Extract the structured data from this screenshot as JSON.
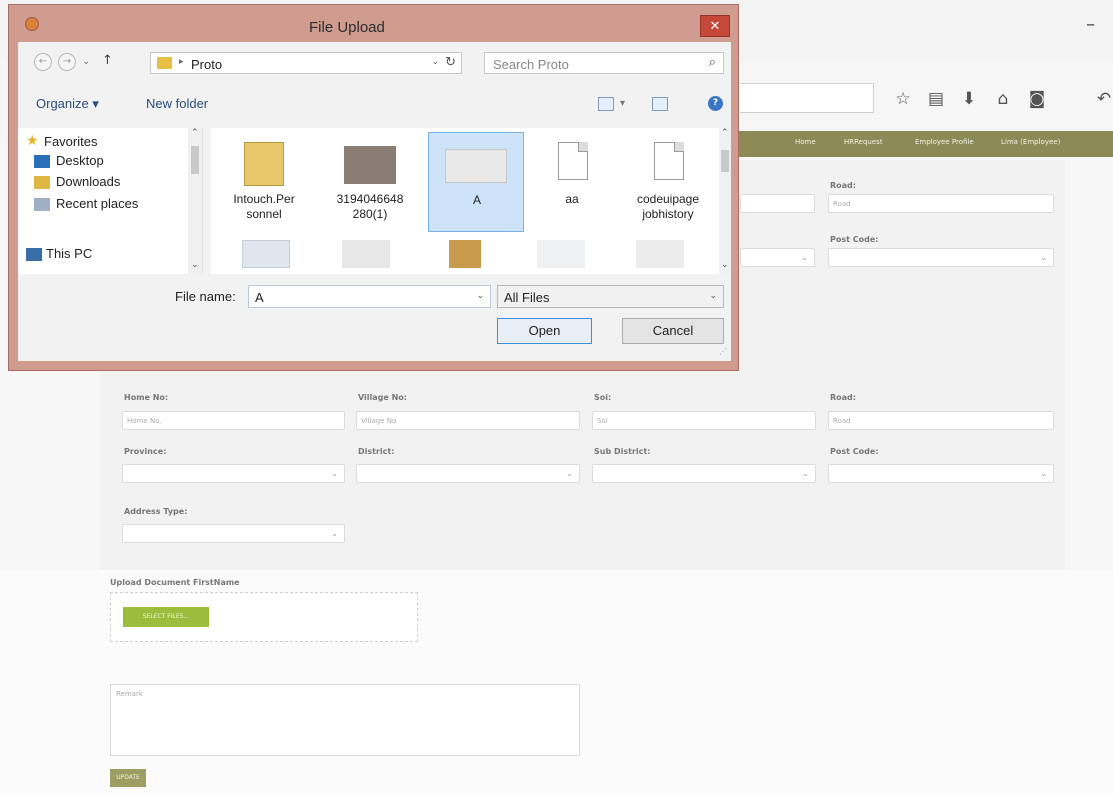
{
  "browser": {
    "minimize": "–",
    "nav_items": [
      "Home",
      "HRRequest",
      "Employee Profile",
      "Lima (Employee)"
    ]
  },
  "form": {
    "upper_row": [
      {
        "label": "Road:",
        "placeholder": "Road"
      },
      {
        "label": "Post Code:",
        "placeholder": ""
      }
    ],
    "address_row1": [
      {
        "label": "Home No:",
        "placeholder": "Home No."
      },
      {
        "label": "Village No:",
        "placeholder": "Village No"
      },
      {
        "label": "Soi:",
        "placeholder": "Soi"
      },
      {
        "label": "Road:",
        "placeholder": "Road"
      }
    ],
    "address_row2": [
      {
        "label": "Province:"
      },
      {
        "label": "District:"
      },
      {
        "label": "Sub District:"
      },
      {
        "label": "Post Code:"
      }
    ],
    "address_type_label": "Address Type:",
    "upload_label": "Upload Document FirstName",
    "select_files": "SELECT FILES...",
    "remark_placeholder": "Remark",
    "update": "UPDATE"
  },
  "dialog": {
    "title": "File Upload",
    "close": "✕",
    "back": "←",
    "forward": "→",
    "up": "↑",
    "path": "Proto",
    "search_placeholder": "Search Proto",
    "organize": "Organize ▾",
    "new_folder": "New folder",
    "help": "?",
    "nav": {
      "favorites": "Favorites",
      "items": [
        "Desktop",
        "Downloads",
        "Recent places"
      ],
      "this_pc": "This PC"
    },
    "files": [
      {
        "name": "Intouch.Per sonnel",
        "icon": "folder-icon"
      },
      {
        "name": "3194046648 280(1)",
        "icon": "photo-thumbnail"
      },
      {
        "name": "A",
        "icon": "image-thumbnail",
        "selected": true
      },
      {
        "name": "aa",
        "icon": "document-icon"
      },
      {
        "name": "codeuipage jobhistory",
        "icon": "document-icon"
      }
    ],
    "file_name_label": "File name:",
    "file_name_value": "A",
    "filter_value": "All Files",
    "open": "Open",
    "cancel": "Cancel"
  },
  "colors": {
    "nav_bar": "#8c8a57",
    "select_files": "#9bbd3c",
    "update_button": "#9e9d62",
    "dialog_frame": "#cf9c8f",
    "close_button": "#c5483a",
    "selected_file": "#cde3f7"
  }
}
